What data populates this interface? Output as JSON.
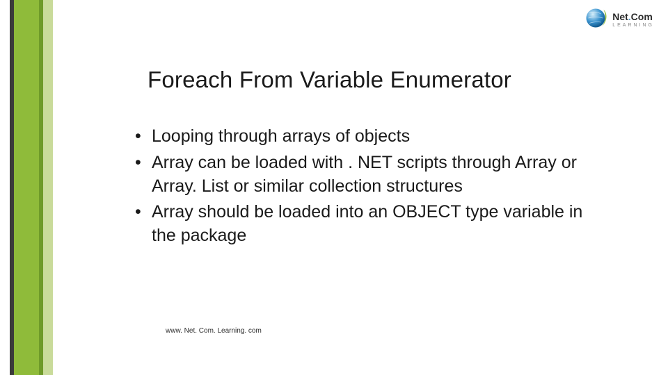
{
  "logo": {
    "brand_main": "Net",
    "brand_dot": ".",
    "brand_tail": "Com",
    "subtext": "LEARNING"
  },
  "title": "Foreach From Variable Enumerator",
  "bullets": [
    "Looping through arrays of objects",
    "Array can be loaded with . NET scripts through Array or Array. List or similar collection structures",
    "Array should be loaded into an OBJECT type variable in the package"
  ],
  "footer_url": "www. Net. Com. Learning. com"
}
